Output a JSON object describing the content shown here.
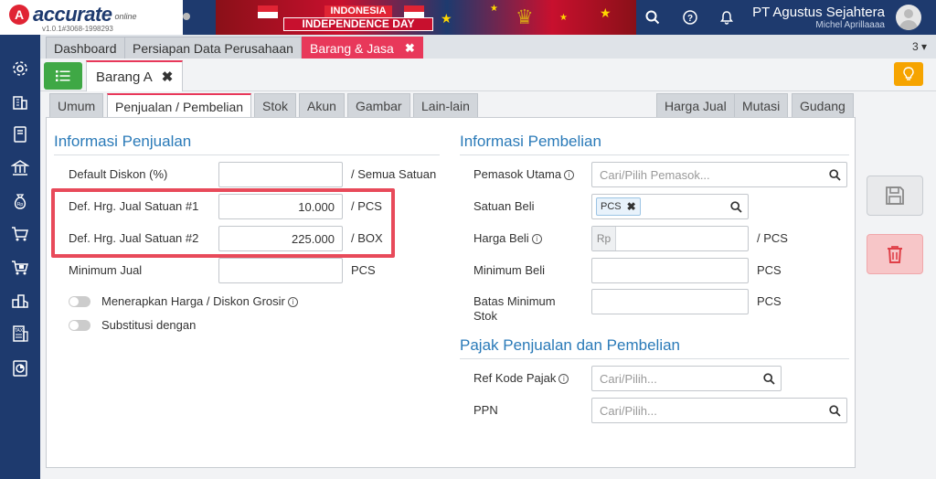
{
  "header": {
    "logo_text": "accurate",
    "logo_sub": "online",
    "version": "v1.0.1#3068-1998293",
    "banner_line1": "INDONESIA",
    "banner_line2": "INDEPENDENCE DAY",
    "company_name": "PT Agustus Sejahtera",
    "user_name": "Michel Aprillaaaa"
  },
  "module_tabs": [
    {
      "label": "Dashboard"
    },
    {
      "label": "Persiapan Data Perusahaan"
    },
    {
      "label": "Barang & Jasa"
    }
  ],
  "module_tab_close": "✖",
  "module_tab_count": "3",
  "document_tab": {
    "label": "Barang A",
    "close": "✖"
  },
  "subtabs_left": [
    "Umum",
    "Penjualan / Pembelian",
    "Stok",
    "Akun",
    "Gambar",
    "Lain-lain"
  ],
  "subtabs_right": [
    "Harga Jual",
    "Mutasi",
    "Gudang"
  ],
  "penjualan": {
    "title": "Informasi Penjualan",
    "default_diskon_label": "Default Diskon (%)",
    "default_diskon_value": "",
    "default_diskon_suffix": "/ Semua Satuan",
    "harga1_label": "Def. Hrg. Jual Satuan #1",
    "harga1_value": "10.000",
    "harga1_suffix": "/ PCS",
    "harga2_label": "Def. Hrg. Jual Satuan #2",
    "harga2_value": "225.000",
    "harga2_suffix": "/ BOX",
    "minimum_jual_label": "Minimum Jual",
    "minimum_jual_value": "",
    "minimum_jual_suffix": "PCS",
    "grosir_label": "Menerapkan Harga / Diskon Grosir",
    "substitusi_label": "Substitusi dengan"
  },
  "pembelian": {
    "title": "Informasi Pembelian",
    "pemasok_label": "Pemasok Utama",
    "pemasok_placeholder": "Cari/Pilih Pemasok...",
    "satuan_beli_label": "Satuan Beli",
    "satuan_beli_chip": "PCS",
    "satuan_beli_chip_close": "✖",
    "harga_beli_label": "Harga Beli",
    "harga_beli_prefix": "Rp",
    "harga_beli_value": "",
    "harga_beli_suffix": "/ PCS",
    "minimum_beli_label": "Minimum Beli",
    "minimum_beli_value": "",
    "minimum_beli_suffix": "PCS",
    "batas_min_label_1": "Batas Minimum",
    "batas_min_label_2": "Stok",
    "batas_min_value": "",
    "batas_min_suffix": "PCS"
  },
  "pajak": {
    "title": "Pajak Penjualan dan Pembelian",
    "ref_kode_label": "Ref Kode Pajak",
    "ref_kode_placeholder": "Cari/Pilih...",
    "ppn_label": "PPN",
    "ppn_placeholder": "Cari/Pilih..."
  },
  "icons": {
    "info": "i",
    "search": "search-icon",
    "save": "floppy-icon",
    "delete": "trash-icon",
    "list": "list-icon",
    "tip": "lightbulb-icon"
  },
  "colors": {
    "header_bg": "#1e3a6e",
    "active_tab": "#e8385a",
    "section_title": "#2a7ab8",
    "highlight": "#e84a5a",
    "list_button": "#3fa845",
    "tip_button": "#f6a400"
  }
}
